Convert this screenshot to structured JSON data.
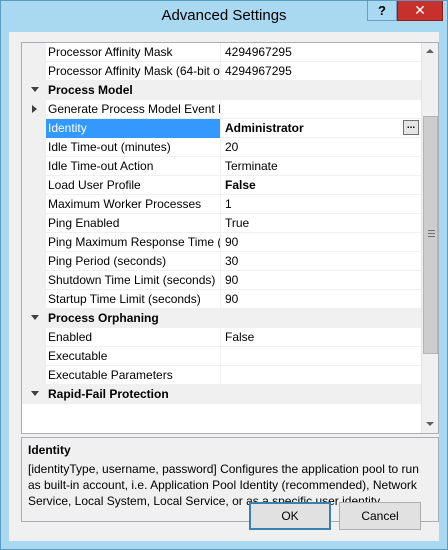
{
  "window": {
    "title": "Advanced Settings",
    "help_label": "?",
    "close_label": "✕"
  },
  "grid": {
    "rows": [
      {
        "kind": "prop",
        "name": "Processor Affinity Mask",
        "value": "4294967295"
      },
      {
        "kind": "prop",
        "name": "Processor Affinity Mask (64-bit o",
        "value": "4294967295"
      },
      {
        "kind": "category",
        "name": "Process Model"
      },
      {
        "kind": "prop",
        "name": "Generate Process Model Event L",
        "value": "",
        "expandable": true
      },
      {
        "kind": "prop",
        "name": "Identity",
        "value": "Administrator",
        "bold": true,
        "selected": true,
        "ellipsis": true
      },
      {
        "kind": "prop",
        "name": "Idle Time-out (minutes)",
        "value": "20"
      },
      {
        "kind": "prop",
        "name": "Idle Time-out Action",
        "value": "Terminate"
      },
      {
        "kind": "prop",
        "name": "Load User Profile",
        "value": "False",
        "bold": true
      },
      {
        "kind": "prop",
        "name": "Maximum Worker Processes",
        "value": "1"
      },
      {
        "kind": "prop",
        "name": "Ping Enabled",
        "value": "True"
      },
      {
        "kind": "prop",
        "name": "Ping Maximum Response Time (",
        "value": "90"
      },
      {
        "kind": "prop",
        "name": "Ping Period (seconds)",
        "value": "30"
      },
      {
        "kind": "prop",
        "name": "Shutdown Time Limit (seconds)",
        "value": "90"
      },
      {
        "kind": "prop",
        "name": "Startup Time Limit (seconds)",
        "value": "90"
      },
      {
        "kind": "category",
        "name": "Process Orphaning"
      },
      {
        "kind": "prop",
        "name": "Enabled",
        "value": "False"
      },
      {
        "kind": "prop",
        "name": "Executable",
        "value": ""
      },
      {
        "kind": "prop",
        "name": "Executable Parameters",
        "value": ""
      },
      {
        "kind": "category",
        "name": "Rapid-Fail Protection"
      }
    ],
    "ellipsis_label": "..."
  },
  "description": {
    "title": "Identity",
    "text": "[identityType, username, password] Configures the application pool to run as built-in account, i.e. Application Pool Identity (recommended), Network Service, Local System, Local Service, or as a specific user identity."
  },
  "buttons": {
    "ok_label": "OK",
    "cancel_label": "Cancel"
  }
}
